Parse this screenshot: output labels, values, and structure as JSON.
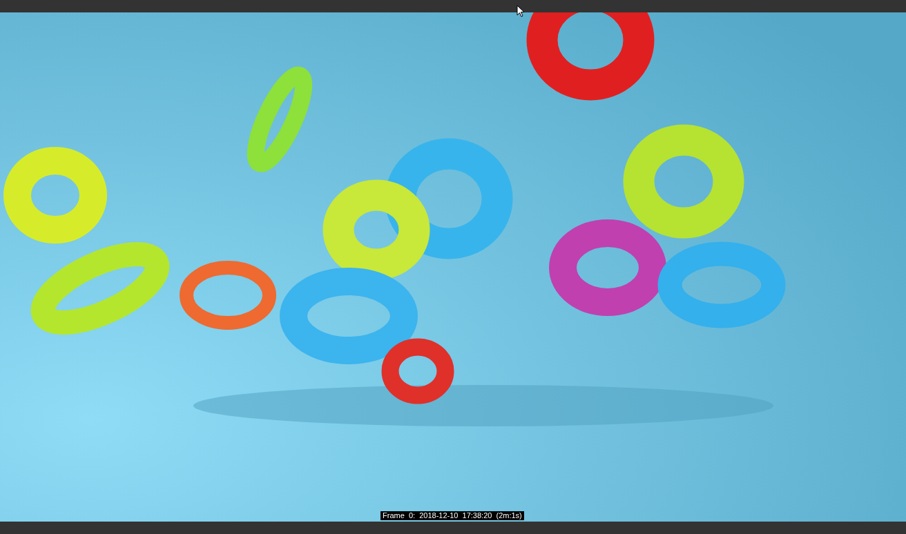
{
  "viewer": {
    "render_stamp": "Frame  0:  2018-12-10  17:38:20  (2m:1s)"
  }
}
